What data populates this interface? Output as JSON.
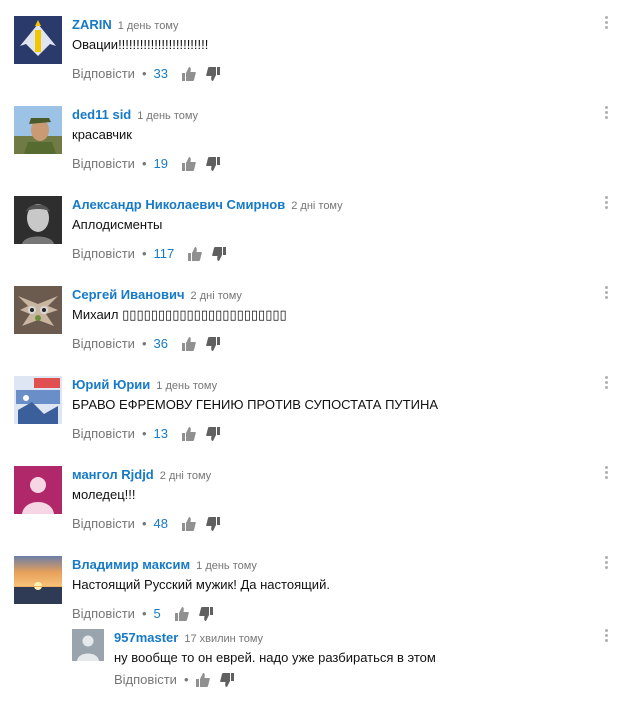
{
  "labels": {
    "reply": "Відповісти",
    "dot": "•"
  },
  "colors": {
    "author": "#167ac6",
    "meta": "#767676",
    "text": "#111111"
  },
  "comments": [
    {
      "author": "ZARIN",
      "time": "1 день тому",
      "text": "Овации!!!!!!!!!!!!!!!!!!!!!!!!!",
      "likes": "33",
      "avatar": "emblem-avatar"
    },
    {
      "author": "ded11 sid",
      "time": "1 день тому",
      "text": "красавчик",
      "likes": "19",
      "avatar": "photo-avatar"
    },
    {
      "author": "Александр Николаевич Смирнов",
      "time": "2 дні тому",
      "text": "Аплодисменты",
      "likes": "117",
      "avatar": "photo-avatar"
    },
    {
      "author": "Сергей Иванович",
      "time": "2 дні тому",
      "text": "Михаил ▯▯▯▯▯▯▯▯▯▯▯▯▯▯▯▯▯▯▯▯▯▯▯",
      "likes": "36",
      "avatar": "creature-avatar"
    },
    {
      "author": "Юрий Юрии",
      "time": "1 день тому",
      "text": "БРАВО ЕФРЕМОВУ ГЕНИЮ ПРОТИВ СУПОСТАТА ПУТИНА",
      "likes": "13",
      "avatar": "poster-avatar"
    },
    {
      "author": "мангол Rjdjd",
      "time": "2 дні тому",
      "text": "моледец!!!",
      "likes": "48",
      "avatar": "default-avatar"
    },
    {
      "author": "Владимир максим",
      "time": "1 день тому",
      "text": "Настоящий Русский мужик!  Да настоящий.",
      "likes": "5",
      "avatar": "sunset-avatar"
    }
  ],
  "reply_comment": {
    "author": "957master",
    "time": "17 хвилин тому",
    "text": "ну вообще то он еврей. надо уже разбираться в этом",
    "likes": "",
    "avatar": "default-avatar"
  }
}
